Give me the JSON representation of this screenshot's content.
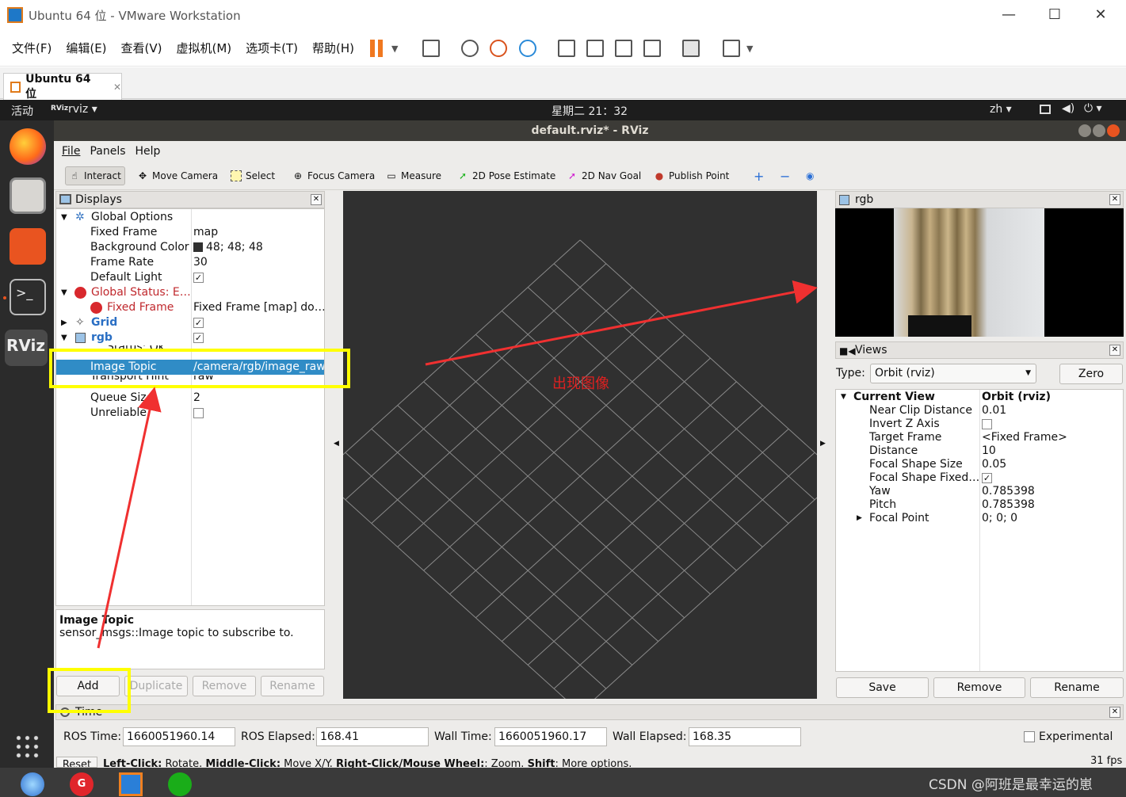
{
  "vmware": {
    "title": "Ubuntu 64 位 - VMware Workstation",
    "menu": [
      "文件(F)",
      "编辑(E)",
      "查看(V)",
      "虚拟机(M)",
      "选项卡(T)",
      "帮助(H)"
    ],
    "tab": "Ubuntu 64 位",
    "minimize": "—",
    "maximize": "☐",
    "close": "✕",
    "tab_close": "✕"
  },
  "ubuntu": {
    "activities": "活动",
    "app": "rviz ▾",
    "clock": "星期二 21：32",
    "lang": "zh ▾",
    "power": "⏻ ▾"
  },
  "rviz": {
    "title": "default.rviz* - RViz",
    "menu": [
      "File",
      "Panels",
      "Help"
    ],
    "tools": [
      "Interact",
      "Move Camera",
      "Select",
      "Focus Camera",
      "Measure",
      "2D Pose Estimate",
      "2D Nav Goal",
      "Publish Point"
    ],
    "displays": {
      "title": "Displays",
      "rows": [
        {
          "k": "Global Options",
          "v": ""
        },
        {
          "k": "Fixed Frame",
          "v": "map"
        },
        {
          "k": "Background Color",
          "v": "48; 48; 48"
        },
        {
          "k": "Frame Rate",
          "v": "30"
        },
        {
          "k": "Default Light",
          "v": "✓"
        },
        {
          "k": "Global Status: E…",
          "v": ""
        },
        {
          "k": "Fixed Frame",
          "v": "Fixed Frame [map] do…"
        },
        {
          "k": "Grid",
          "v": "✓"
        },
        {
          "k": "rgb",
          "v": "✓"
        },
        {
          "k": "Status: Ok",
          "v": ""
        },
        {
          "k": "Image Topic",
          "v": "/camera/rgb/image_raw"
        },
        {
          "k": "Transport Hint",
          "v": "raw"
        },
        {
          "k": "Queue Size",
          "v": "2"
        },
        {
          "k": "Unreliable",
          "v": ""
        }
      ],
      "desc_title": "Image Topic",
      "desc_text": "sensor_msgs::Image topic to subscribe to.",
      "buttons": [
        "Add",
        "Duplicate",
        "Remove",
        "Rename"
      ]
    },
    "rgb_panel": {
      "title": "rgb"
    },
    "views": {
      "title": "Views",
      "type_label": "Type:",
      "type_value": "Orbit (rviz)",
      "zero": "Zero",
      "rows": [
        {
          "k": "Current View",
          "v": "Orbit (rviz)"
        },
        {
          "k": "Near Clip Distance",
          "v": "0.01"
        },
        {
          "k": "Invert Z Axis",
          "v": ""
        },
        {
          "k": "Target Frame",
          "v": "<Fixed Frame>"
        },
        {
          "k": "Distance",
          "v": "10"
        },
        {
          "k": "Focal Shape Size",
          "v": "0.05"
        },
        {
          "k": "Focal Shape Fixed…",
          "v": "✓"
        },
        {
          "k": "Yaw",
          "v": "0.785398"
        },
        {
          "k": "Pitch",
          "v": "0.785398"
        },
        {
          "k": "Focal Point",
          "v": "0; 0; 0"
        }
      ],
      "buttons": [
        "Save",
        "Remove",
        "Rename"
      ]
    },
    "time": {
      "title": "Time",
      "ros_time_label": "ROS Time:",
      "ros_time": "1660051960.14",
      "ros_elapsed_label": "ROS Elapsed:",
      "ros_elapsed": "168.41",
      "wall_time_label": "Wall Time:",
      "wall_time": "1660051960.17",
      "wall_elapsed_label": "Wall Elapsed:",
      "wall_elapsed": "168.35",
      "experimental": "Experimental"
    },
    "status": {
      "reset": "Reset",
      "hint_b1": "Left-Click:",
      "hint_t1": " Rotate. ",
      "hint_b2": "Middle-Click:",
      "hint_t2": " Move X/Y. ",
      "hint_b3": "Right-Click/Mouse Wheel:",
      "hint_t3": ": Zoom. ",
      "hint_b4": "Shift",
      "hint_t4": ": More options.",
      "fps": "31 fps"
    }
  },
  "annotation": {
    "text": "出现图像"
  },
  "watermark": "CSDN @阿班是最幸运的崽"
}
